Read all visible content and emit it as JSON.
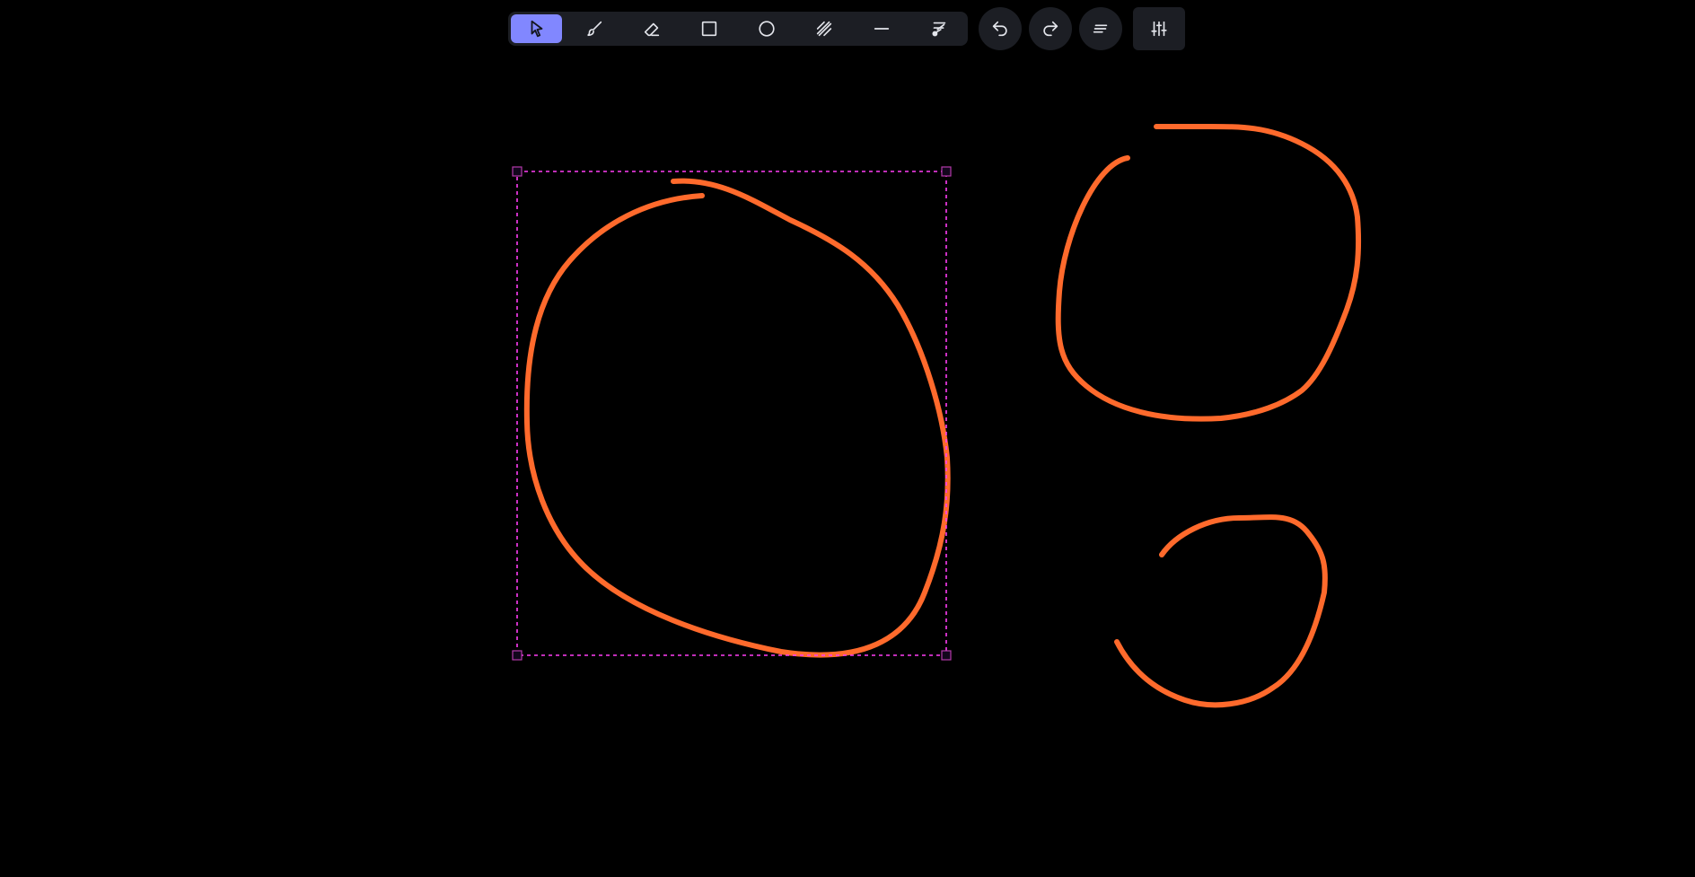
{
  "toolbar": {
    "tools": [
      {
        "name": "select-tool",
        "icon": "pointer-icon",
        "active": true
      },
      {
        "name": "brush-tool",
        "icon": "brush-icon",
        "active": false
      },
      {
        "name": "eraser-tool",
        "icon": "eraser-icon",
        "active": false
      },
      {
        "name": "rectangle-tool",
        "icon": "square-icon",
        "active": false
      },
      {
        "name": "ellipse-tool",
        "icon": "circle-icon",
        "active": false
      },
      {
        "name": "hatch-tool",
        "icon": "hatch-icon",
        "active": false
      },
      {
        "name": "line-tool",
        "icon": "line-icon",
        "active": false
      },
      {
        "name": "clear-tool",
        "icon": "clear-brush-icon",
        "active": false
      }
    ],
    "actions": [
      {
        "name": "undo-button",
        "icon": "undo-icon"
      },
      {
        "name": "redo-button",
        "icon": "redo-icon"
      },
      {
        "name": "menu-button",
        "icon": "text-lines-icon"
      }
    ],
    "settings": {
      "name": "settings-button",
      "icon": "sliders-icon"
    }
  },
  "canvas": {
    "background": "#000000",
    "stroke_color": "#ff6a2c",
    "selection_color": "#ff3df5",
    "strokes": [
      "large-loop-stroke",
      "upper-right-loop-stroke",
      "lower-right-loop-stroke"
    ],
    "selected_stroke": "large-loop-stroke"
  },
  "colors": {
    "toolbar_bg": "#1c1e24",
    "active_tool_bg": "#8187ff",
    "icon": "#e3e5eb"
  }
}
